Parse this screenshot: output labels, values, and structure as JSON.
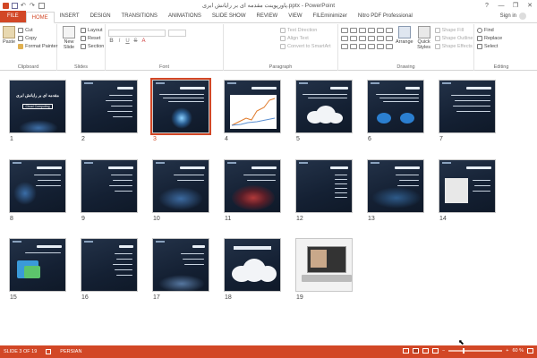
{
  "window": {
    "title": "پاورپوینت مقدمه ای بر رایانش ابری.pptx - PowerPoint",
    "controls": [
      "?",
      "—",
      "❐",
      "✕"
    ]
  },
  "tabs": [
    {
      "label": "FILE"
    },
    {
      "label": "HOME"
    },
    {
      "label": "INSERT"
    },
    {
      "label": "DESIGN"
    },
    {
      "label": "TRANSITIONS"
    },
    {
      "label": "ANIMATIONS"
    },
    {
      "label": "SLIDE SHOW"
    },
    {
      "label": "REVIEW"
    },
    {
      "label": "VIEW"
    },
    {
      "label": "FILEminimizer"
    },
    {
      "label": "Nitro PDF Professional"
    }
  ],
  "signin": "Sign in",
  "ribbon": {
    "clipboard": {
      "label": "Clipboard",
      "paste": "Paste",
      "cut": "Cut",
      "copy": "Copy",
      "format_painter": "Format Painter"
    },
    "slides": {
      "label": "Slides",
      "new_slide": "New Slide",
      "layout": "Layout",
      "reset": "Reset",
      "section": "Section"
    },
    "font": {
      "label": "Font"
    },
    "paragraph": {
      "label": "Paragraph",
      "text_direction": "Text Direction",
      "align_text": "Align Text",
      "convert": "Convert to SmartArt"
    },
    "drawing": {
      "label": "Drawing",
      "arrange": "Arrange",
      "quick_styles": "Quick Styles",
      "shape_fill": "Shape Fill",
      "shape_outline": "Shape Outline",
      "shape_effects": "Shape Effects"
    },
    "editing": {
      "label": "Editing",
      "find": "Find",
      "replace": "Replace",
      "select": "Select"
    }
  },
  "slides": [
    {
      "num": "1",
      "title_text": "مقدمه ای بر رایانش ابری",
      "subtitle": "Cloud Computing"
    },
    {
      "num": "2"
    },
    {
      "num": "3",
      "selected": true
    },
    {
      "num": "4"
    },
    {
      "num": "5"
    },
    {
      "num": "6"
    },
    {
      "num": "7"
    },
    {
      "num": "8"
    },
    {
      "num": "9"
    },
    {
      "num": "10"
    },
    {
      "num": "11"
    },
    {
      "num": "12"
    },
    {
      "num": "13"
    },
    {
      "num": "14"
    },
    {
      "num": "15"
    },
    {
      "num": "16"
    },
    {
      "num": "17"
    },
    {
      "num": "18"
    },
    {
      "num": "19"
    }
  ],
  "status": {
    "slide": "SLIDE 3 OF 19",
    "language": "PERSIAN",
    "zoom": "60 %",
    "zoom_level": 60
  },
  "colors": {
    "accent": "#d24726",
    "slide_bg": "#1b2a3f"
  }
}
